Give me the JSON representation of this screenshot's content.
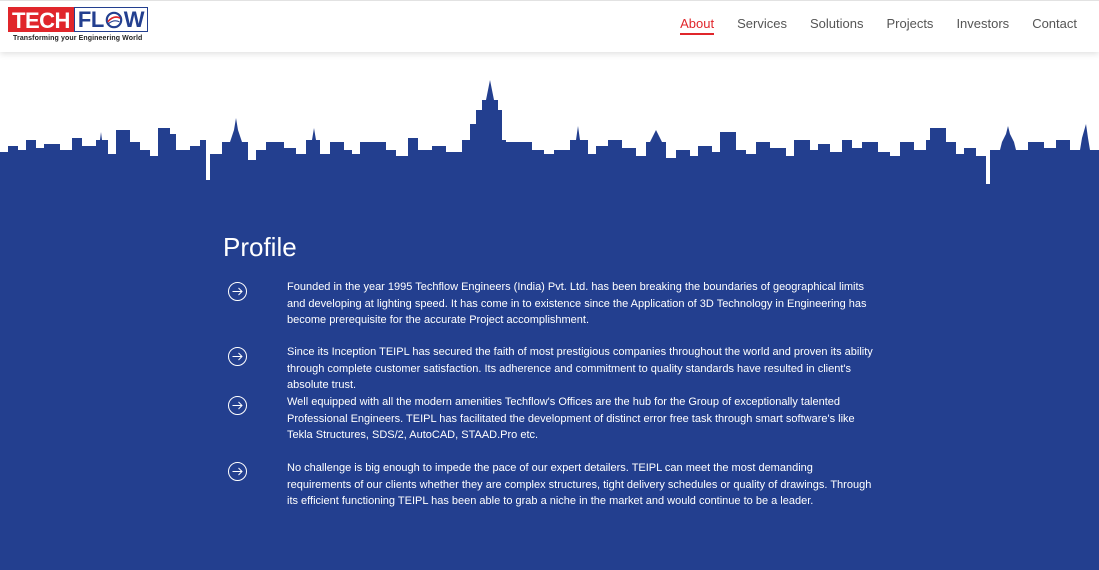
{
  "brand": {
    "logo_part1": "TECH",
    "logo_part2a": "FL",
    "logo_part2b": "W",
    "tagline": "Transforming your Engineering World",
    "red": "#e0262b",
    "blue": "#233f8f"
  },
  "nav": {
    "items": [
      {
        "label": "About",
        "active": true
      },
      {
        "label": "Services",
        "active": false
      },
      {
        "label": "Solutions",
        "active": false
      },
      {
        "label": "Projects",
        "active": false
      },
      {
        "label": "Investors",
        "active": false
      },
      {
        "label": "Contact",
        "active": false
      }
    ]
  },
  "profile": {
    "title": "Profile",
    "icon": "arrow-circle-icon",
    "paragraphs": [
      "Founded in the year 1995 Techflow Engineers (India) Pvt. Ltd. has been breaking the boundaries of geographical limits and developing at lighting speed. It has come in to existence since the Application of 3D Technology in Engineering has become prerequisite for the accurate Project accomplishment.",
      "Since its Inception TEIPL has secured the faith of most prestigious companies throughout the world and proven its ability through complete customer satisfaction. Its adherence and commitment to quality standards have resulted in client's absolute trust.",
      "Well equipped with all the modern amenities Techflow's Offices are the hub for the Group of exceptionally talented Professional Engineers. TEIPL has facilitated the development of distinct error free task through smart software's like Tekla Structures, SDS/2, AutoCAD, STAAD.Pro etc.",
      "No challenge is big enough to impede the pace of our expert detailers. TEIPL can meet the most demanding requirements of our clients whether they are complex structures, tight delivery schedules or quality of drawings. Through its efficient functioning TEIPL has been able to grab a niche in the market and would continue to be a leader."
    ]
  }
}
